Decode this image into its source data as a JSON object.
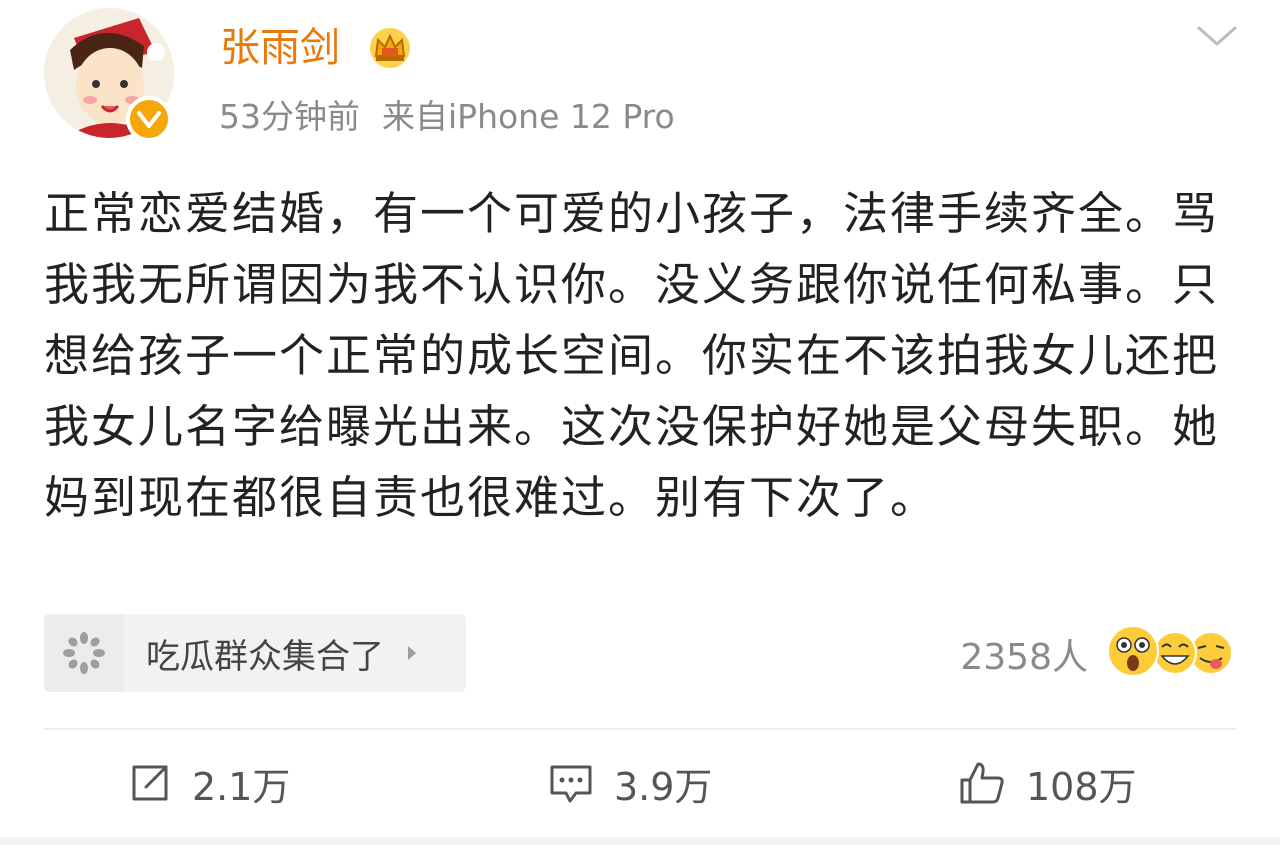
{
  "post": {
    "author": {
      "name": "张雨剑",
      "avatar_icon": "cartoon-avatar-icon",
      "badge_icon": "verified-icon",
      "crown_icon": "crown-icon"
    },
    "time": "53分钟前",
    "source": "来自iPhone 12 Pro",
    "text": "正常恋爱结婚，有一个可爱的小孩子，法律手续齐全。骂我我无所谓因为我不认识你。没义务跟你说任何私事。只想给孩子一个正常的成长空间。你实在不该拍我女儿还把我女儿名字给曝光出来。这次没保护好她是父母失职。她妈到现在都很自责也很难过。别有下次了。"
  },
  "topic": {
    "label": "吃瓜群众集合了",
    "icon": "melon-seed-icon"
  },
  "reactions": {
    "count": "2358人",
    "emojis": [
      "surprised-emoji-icon",
      "laughing-emoji-icon",
      "tongue-emoji-icon"
    ]
  },
  "actions": {
    "repost": "2.1万",
    "comment": "3.9万",
    "like": "108万"
  },
  "colors": {
    "username": "#e8790a",
    "verified": "#f5a60a",
    "meta_text": "#8a8a8a",
    "body_text": "#222222"
  }
}
